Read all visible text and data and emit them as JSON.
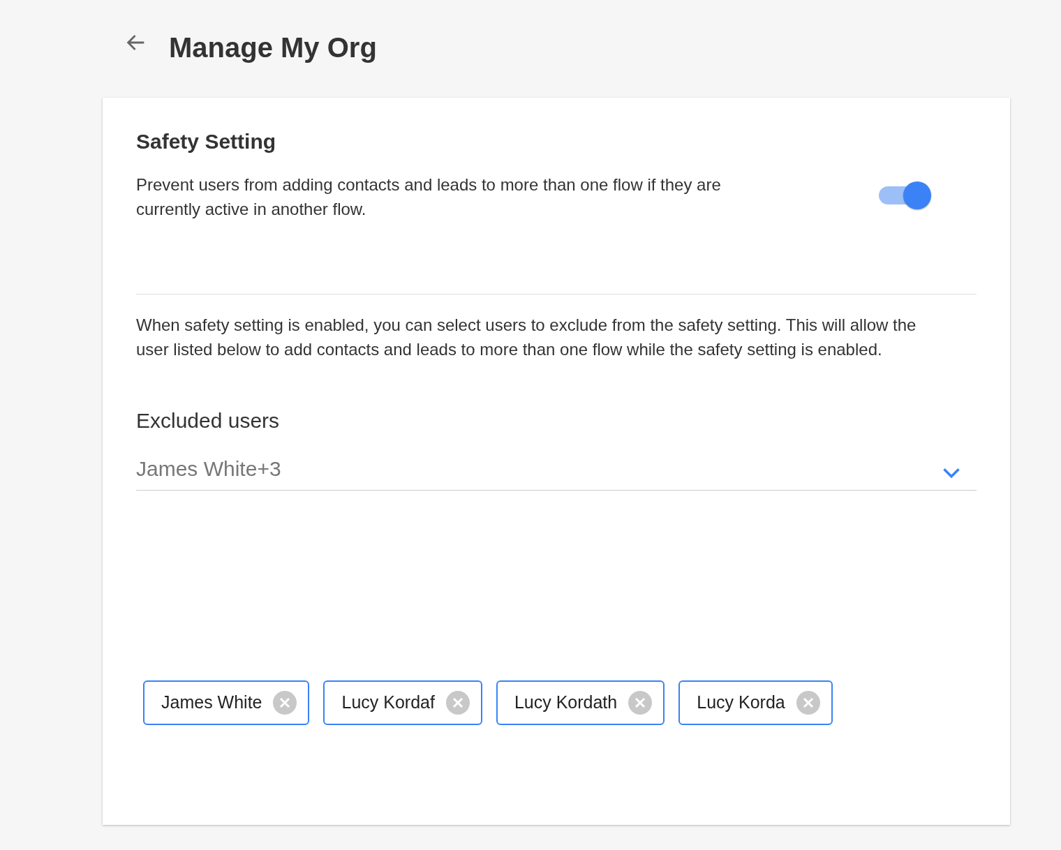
{
  "header": {
    "title": "Manage My Org"
  },
  "safety": {
    "title": "Safety Setting",
    "description": "Prevent users from adding contacts and leads to more than one flow if they are currently active in another flow.",
    "on": true
  },
  "exclusion_note": "When safety setting is enabled, you can select users to exclude from the safety setting. This will allow the user listed below to add contacts and leads to more than one flow while the safety setting is enabled.",
  "excluded_users": {
    "label": "Excluded users",
    "value": "James White+3",
    "chips": [
      {
        "label": "James White"
      },
      {
        "label": "Lucy Kordaf"
      },
      {
        "label": "Lucy Kordath"
      },
      {
        "label": "Lucy Korda"
      }
    ]
  }
}
